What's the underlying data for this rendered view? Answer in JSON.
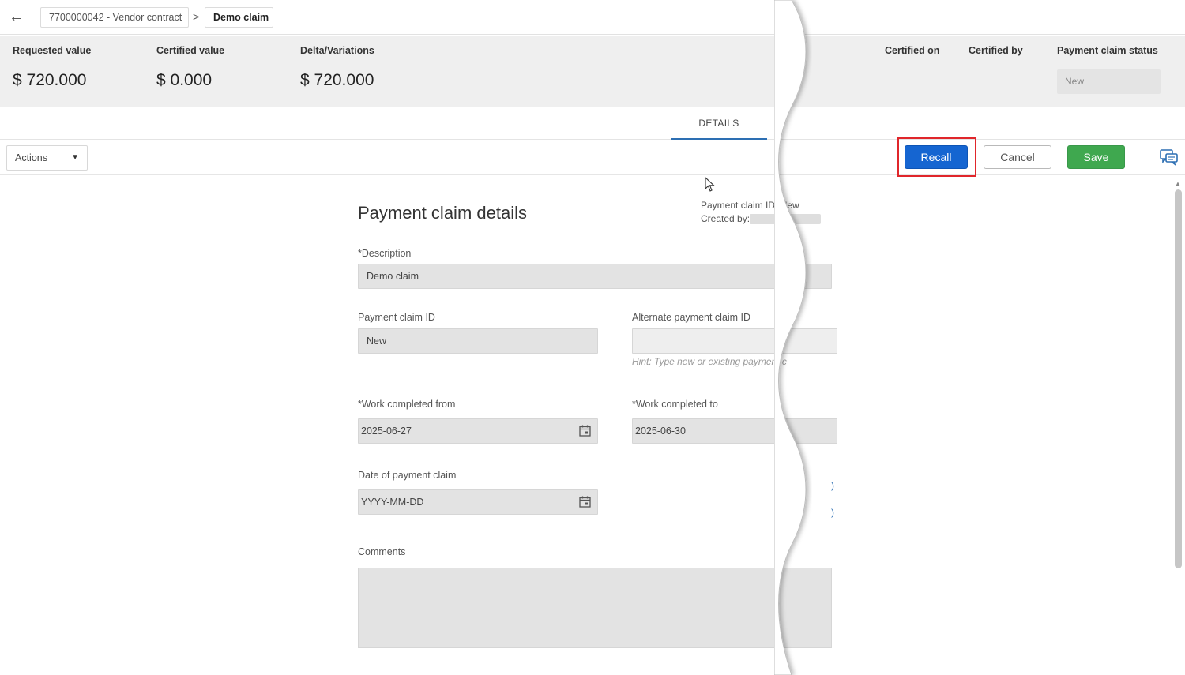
{
  "breadcrumb": {
    "contract_label": "7700000042 - Vendor contract",
    "separator": ">",
    "current_label": "Demo claim"
  },
  "summary": {
    "requested_label": "Requested value",
    "requested_value": "$ 720.000",
    "certified_label": "Certified value",
    "certified_value": "$ 0.000",
    "delta_label": "Delta/Variations",
    "delta_value": "$ 720.000",
    "certified_on_label": "Certified on",
    "certified_by_label": "Certified by",
    "status_label": "Payment claim status",
    "status_value": "New"
  },
  "tabs": {
    "details_label": "DETAILS"
  },
  "toolbar": {
    "actions_label": "Actions",
    "recall_label": "Recall",
    "cancel_label": "Cancel",
    "save_label": "Save"
  },
  "form": {
    "title": "Payment claim details",
    "meta_id": "Payment claim ID: New",
    "meta_created_by": "Created by:",
    "description_label": "*Description",
    "description_value": "Demo claim",
    "claim_id_label": "Payment claim ID",
    "claim_id_value": "New",
    "alt_claim_id_label": "Alternate payment claim ID",
    "alt_claim_id_hint": "Hint: Type new or existing payment c",
    "work_from_label": "*Work completed from",
    "work_from_value": "2025-06-27",
    "work_to_label": "*Work completed to",
    "work_to_value": "2025-06-30",
    "date_claim_label": "Date of payment claim",
    "date_claim_placeholder": "YYYY-MM-DD",
    "comments_label": "Comments"
  },
  "colors": {
    "recall_button": "#1565d1",
    "save_button": "#3fa84f",
    "highlight": "#e0262b",
    "tab_underline": "#2d6fb3"
  },
  "icons": [
    "back-arrow-icon",
    "chevron-right-icon",
    "dropdown-caret-icon",
    "comments-icon",
    "calendar-icon",
    "cursor-icon"
  ]
}
